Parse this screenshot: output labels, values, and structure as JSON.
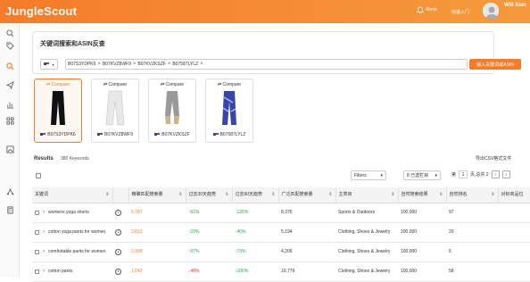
{
  "header": {
    "logo": "JungleScout",
    "alerts_label": "Alerts",
    "quick_start": "快速入门",
    "username": "Will Xian"
  },
  "search": {
    "title": "关键词搜索和ASIN反查",
    "asins": [
      "B07S3YDPK6",
      "B07KVZ8WF9",
      "B07KVZKSZF",
      "B07587LYLZ"
    ],
    "reverse_button": "输入关键词或ASIN"
  },
  "products": [
    {
      "compare_label": "Compare",
      "asin": "B07S3YDPK6",
      "selected": true
    },
    {
      "compare_label": "Compare",
      "asin": "B07KVZ8WF9",
      "selected": false
    },
    {
      "compare_label": "Compare",
      "asin": "B07KVZKSZF",
      "selected": false
    },
    {
      "compare_label": "Compare",
      "asin": "B07587LYLZ",
      "selected": false
    }
  ],
  "results": {
    "label": "Results",
    "count": "380 Keywords",
    "export": "导出CSV格式文件",
    "filters": "Filters",
    "columns_selected": "8 已选栏目",
    "page_label": "第",
    "page": "1",
    "page_total": "页,总共 2"
  },
  "table": {
    "headers": [
      "关键词",
      "",
      "精确匹配搜索量",
      "过去30天趋势",
      "过去90天趋势",
      "广泛匹配搜索量",
      "主类目",
      "自然搜索结果",
      "自然排名",
      "对标商品位"
    ],
    "rows": [
      {
        "keyword": "womens yoga shorts",
        "exact": "5,787",
        "trend30": "↑61%",
        "trend30_dir": "up",
        "trend90": "↑126%",
        "trend90_dir": "up",
        "broad": "8,375",
        "category": "Sports & Outdoors",
        "organic_results": "100,000",
        "organic_rank": "97"
      },
      {
        "keyword": "cotton yoga pants for women",
        "exact": "3,813",
        "trend30": "↑10%",
        "trend30_dir": "up",
        "trend90": "↑46%",
        "trend90_dir": "up",
        "broad": "5,194",
        "category": "Clothing, Shoes & Jewelry",
        "organic_results": "100,000",
        "organic_rank": "20"
      },
      {
        "keyword": "comfortable pants for women",
        "exact": "2,999",
        "trend30": "↑57%",
        "trend30_dir": "up",
        "trend90": "↑73%",
        "trend90_dir": "up",
        "broad": "4,206",
        "category": "Clothing, Shoes & Jewelry",
        "organic_results": "100,000",
        "organic_rank": "6"
      },
      {
        "keyword": "cotton pants",
        "exact": "1,542",
        "trend30": "↓48%",
        "trend30_dir": "down",
        "trend90": "↑100%",
        "trend90_dir": "up",
        "broad": "19,779",
        "category": "Clothing, Shoes & Jewelry",
        "organic_results": "100,000",
        "organic_rank": "58"
      }
    ]
  },
  "colors": {
    "accent": "#f57c2a",
    "up": "#2aa24e",
    "down": "#d63a3a"
  }
}
